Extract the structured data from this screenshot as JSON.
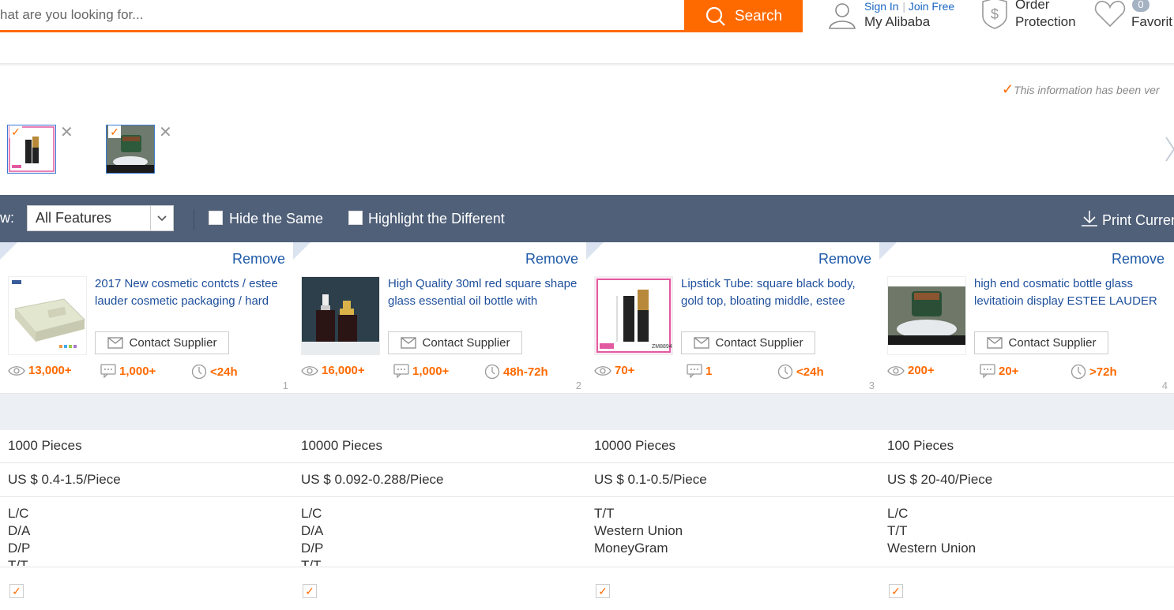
{
  "header": {
    "search_placeholder": "hat are you looking for...",
    "search_button": "Search",
    "sign_in": "Sign In",
    "join_free": "Join Free",
    "my_alibaba": "My Alibaba",
    "order_line1": "Order",
    "order_line2": "Protection",
    "favorites_count": "0",
    "favorites_label": "Favorit",
    "accent_color": "#ff6a00"
  },
  "verified_note": "This information has been ver",
  "compare_thumbs": [
    {
      "icon": "lipstick-tube-thumbnail"
    },
    {
      "icon": "cosmetic-jar-thumbnail"
    }
  ],
  "toolbar": {
    "view_label": "w:",
    "view_select": "All Features",
    "hide_same": "Hide the Same",
    "highlight_diff": "Highlight the Different",
    "print": "Print Curren",
    "bg_color": "#506079"
  },
  "products": [
    {
      "remove": "Remove",
      "title": "2017 New cosmetic contcts / estee lauder cosmetic packaging / hard",
      "contact": "Contact Supplier",
      "views": "13,000+",
      "messages": "1,000+",
      "response": "<24h",
      "index": "1",
      "moq": "1000 Pieces",
      "price": "US $ 0.4-1.5/Piece",
      "payment": [
        "L/C",
        "D/A",
        "D/P",
        "T/T"
      ]
    },
    {
      "remove": "Remove",
      "title": "High Quality 30ml red square shape glass essential oil bottle with",
      "contact": "Contact Supplier",
      "views": "16,000+",
      "messages": "1,000+",
      "response": "48h-72h",
      "index": "2",
      "moq": "10000 Pieces",
      "price": "US $ 0.092-0.288/Piece",
      "payment": [
        "L/C",
        "D/A",
        "D/P",
        "T/T"
      ]
    },
    {
      "remove": "Remove",
      "title": "Lipstick Tube: square black body, gold top, bloating middle, estee",
      "contact": "Contact Supplier",
      "views": "70+",
      "messages": "1",
      "response": "<24h",
      "index": "3",
      "moq": "10000 Pieces",
      "price": "US $ 0.1-0.5/Piece",
      "payment": [
        "T/T",
        "Western Union",
        "MoneyGram"
      ]
    },
    {
      "remove": "Remove",
      "title": "high end cosmatic bottle glass levitatioin display ESTEE LAUDER",
      "contact": "Contact Supplier",
      "views": "200+",
      "messages": "20+",
      "response": ">72h",
      "index": "4",
      "moq": "100 Pieces",
      "price": "US $ 20-40/Piece",
      "payment": [
        "L/C",
        "T/T",
        "Western Union"
      ]
    }
  ]
}
